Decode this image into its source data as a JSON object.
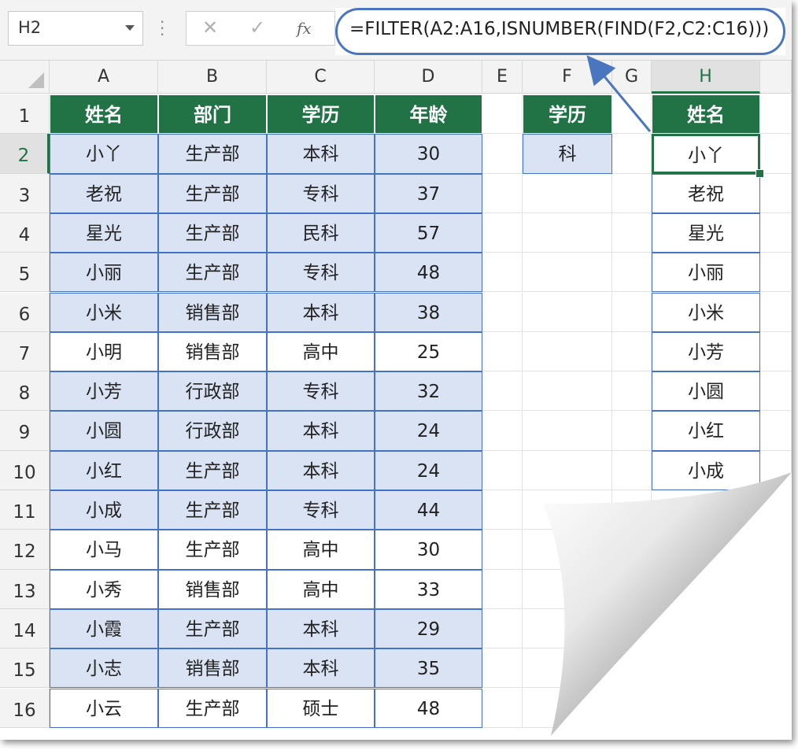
{
  "name_box": "H2",
  "formula_bar": {
    "cancel_icon": "✕",
    "enter_icon": "✓",
    "fx_label": "fx",
    "formula": "=FILTER(A2:A16,ISNUMBER(FIND(F2,C2:C16)))"
  },
  "columns": [
    "A",
    "B",
    "C",
    "D",
    "E",
    "F",
    "G",
    "H"
  ],
  "rows": [
    "1",
    "2",
    "3",
    "4",
    "5",
    "6",
    "7",
    "8",
    "9",
    "10",
    "11",
    "12",
    "13",
    "14",
    "15",
    "16"
  ],
  "table": {
    "headers": [
      "姓名",
      "部门",
      "学历",
      "年龄"
    ],
    "rows": [
      [
        "小丫",
        "生产部",
        "本科",
        "30"
      ],
      [
        "老祝",
        "生产部",
        "专科",
        "37"
      ],
      [
        "星光",
        "生产部",
        "民科",
        "57"
      ],
      [
        "小丽",
        "生产部",
        "专科",
        "48"
      ],
      [
        "小米",
        "销售部",
        "本科",
        "38"
      ],
      [
        "小明",
        "销售部",
        "高中",
        "25"
      ],
      [
        "小芳",
        "行政部",
        "专科",
        "32"
      ],
      [
        "小圆",
        "行政部",
        "本科",
        "24"
      ],
      [
        "小红",
        "生产部",
        "本科",
        "24"
      ],
      [
        "小成",
        "生产部",
        "专科",
        "44"
      ],
      [
        "小马",
        "生产部",
        "高中",
        "30"
      ],
      [
        "小秀",
        "销售部",
        "高中",
        "33"
      ],
      [
        "小霞",
        "生产部",
        "本科",
        "29"
      ],
      [
        "小志",
        "销售部",
        "本科",
        "35"
      ],
      [
        "小云",
        "生产部",
        "硕士",
        "48"
      ]
    ]
  },
  "criteria": {
    "header": "学历",
    "value": "科"
  },
  "result": {
    "header": "姓名",
    "values": [
      "小丫",
      "老祝",
      "星光",
      "小丽",
      "小米",
      "小芳",
      "小圆",
      "小红",
      "小成"
    ]
  },
  "colors": {
    "header_green": "#217346",
    "table_shade": "#dae3f3",
    "border_blue": "#4472c4",
    "callout": "#4a76c0"
  }
}
